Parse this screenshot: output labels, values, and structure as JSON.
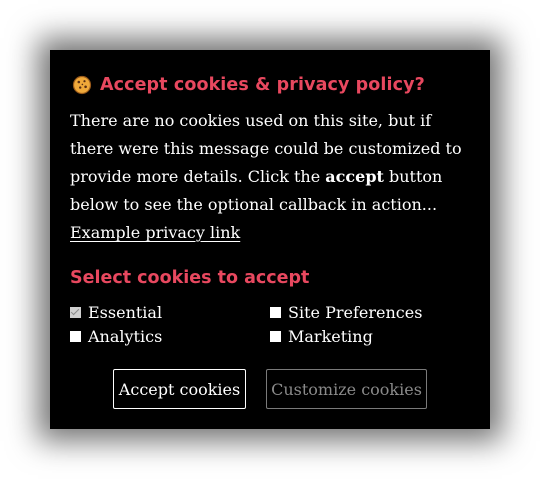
{
  "modal": {
    "icon": "cookie-icon",
    "title": "Accept cookies & privacy policy?",
    "description": {
      "before_bold": "There are no cookies used on this site, but if there were this message could be customized to provide more details. Click the ",
      "bold": "accept",
      "after_bold": " button below to see the optional callback in action... ",
      "link_text": "Example privacy link"
    },
    "section_title": "Select cookies to accept",
    "options": {
      "essential": {
        "label": "Essential",
        "checked": true,
        "disabled": true
      },
      "site_preferences": {
        "label": "Site Preferences",
        "checked": false
      },
      "analytics": {
        "label": "Analytics",
        "checked": false
      },
      "marketing": {
        "label": "Marketing",
        "checked": false
      }
    },
    "buttons": {
      "accept": "Accept cookies",
      "customize": "Customize cookies"
    }
  },
  "colors": {
    "accent": "#e8485f",
    "background": "#000000",
    "text": "#ffffff"
  }
}
